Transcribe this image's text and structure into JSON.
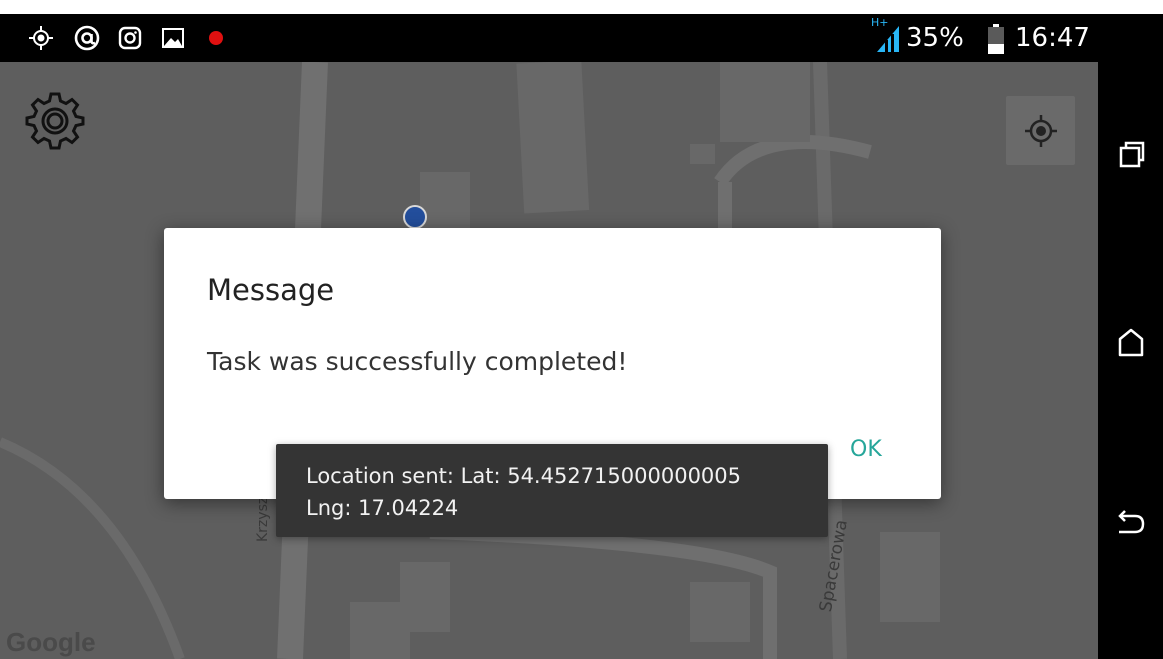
{
  "status_bar": {
    "icons": [
      "gps-icon",
      "at-sign-icon",
      "instagram-icon",
      "gallery-icon",
      "recording-dot-icon",
      "hplus-signal-icon",
      "battery-icon"
    ],
    "network_label": "H+",
    "battery_percent": "35%",
    "time": "16:47"
  },
  "map": {
    "settings_icon": "gear-icon",
    "my_location_icon": "crosshair-icon",
    "google_logo": "Google",
    "streets": [
      "Krzyszt",
      "Spacerowa"
    ]
  },
  "dialog": {
    "title": "Message",
    "message": "Task was successfully completed!",
    "ok_label": "OK"
  },
  "toast": {
    "line1": "Location sent: Lat: 54.452715000000005",
    "line2": "Lng: 17.04224"
  },
  "nav_bar": {
    "icons": [
      "recent-apps-icon",
      "home-icon",
      "back-icon"
    ]
  },
  "colors": {
    "accent": "#26a69a",
    "map_background": "#5e5e5e",
    "location_dot": "#234e9c",
    "toast_background": "#343434"
  }
}
